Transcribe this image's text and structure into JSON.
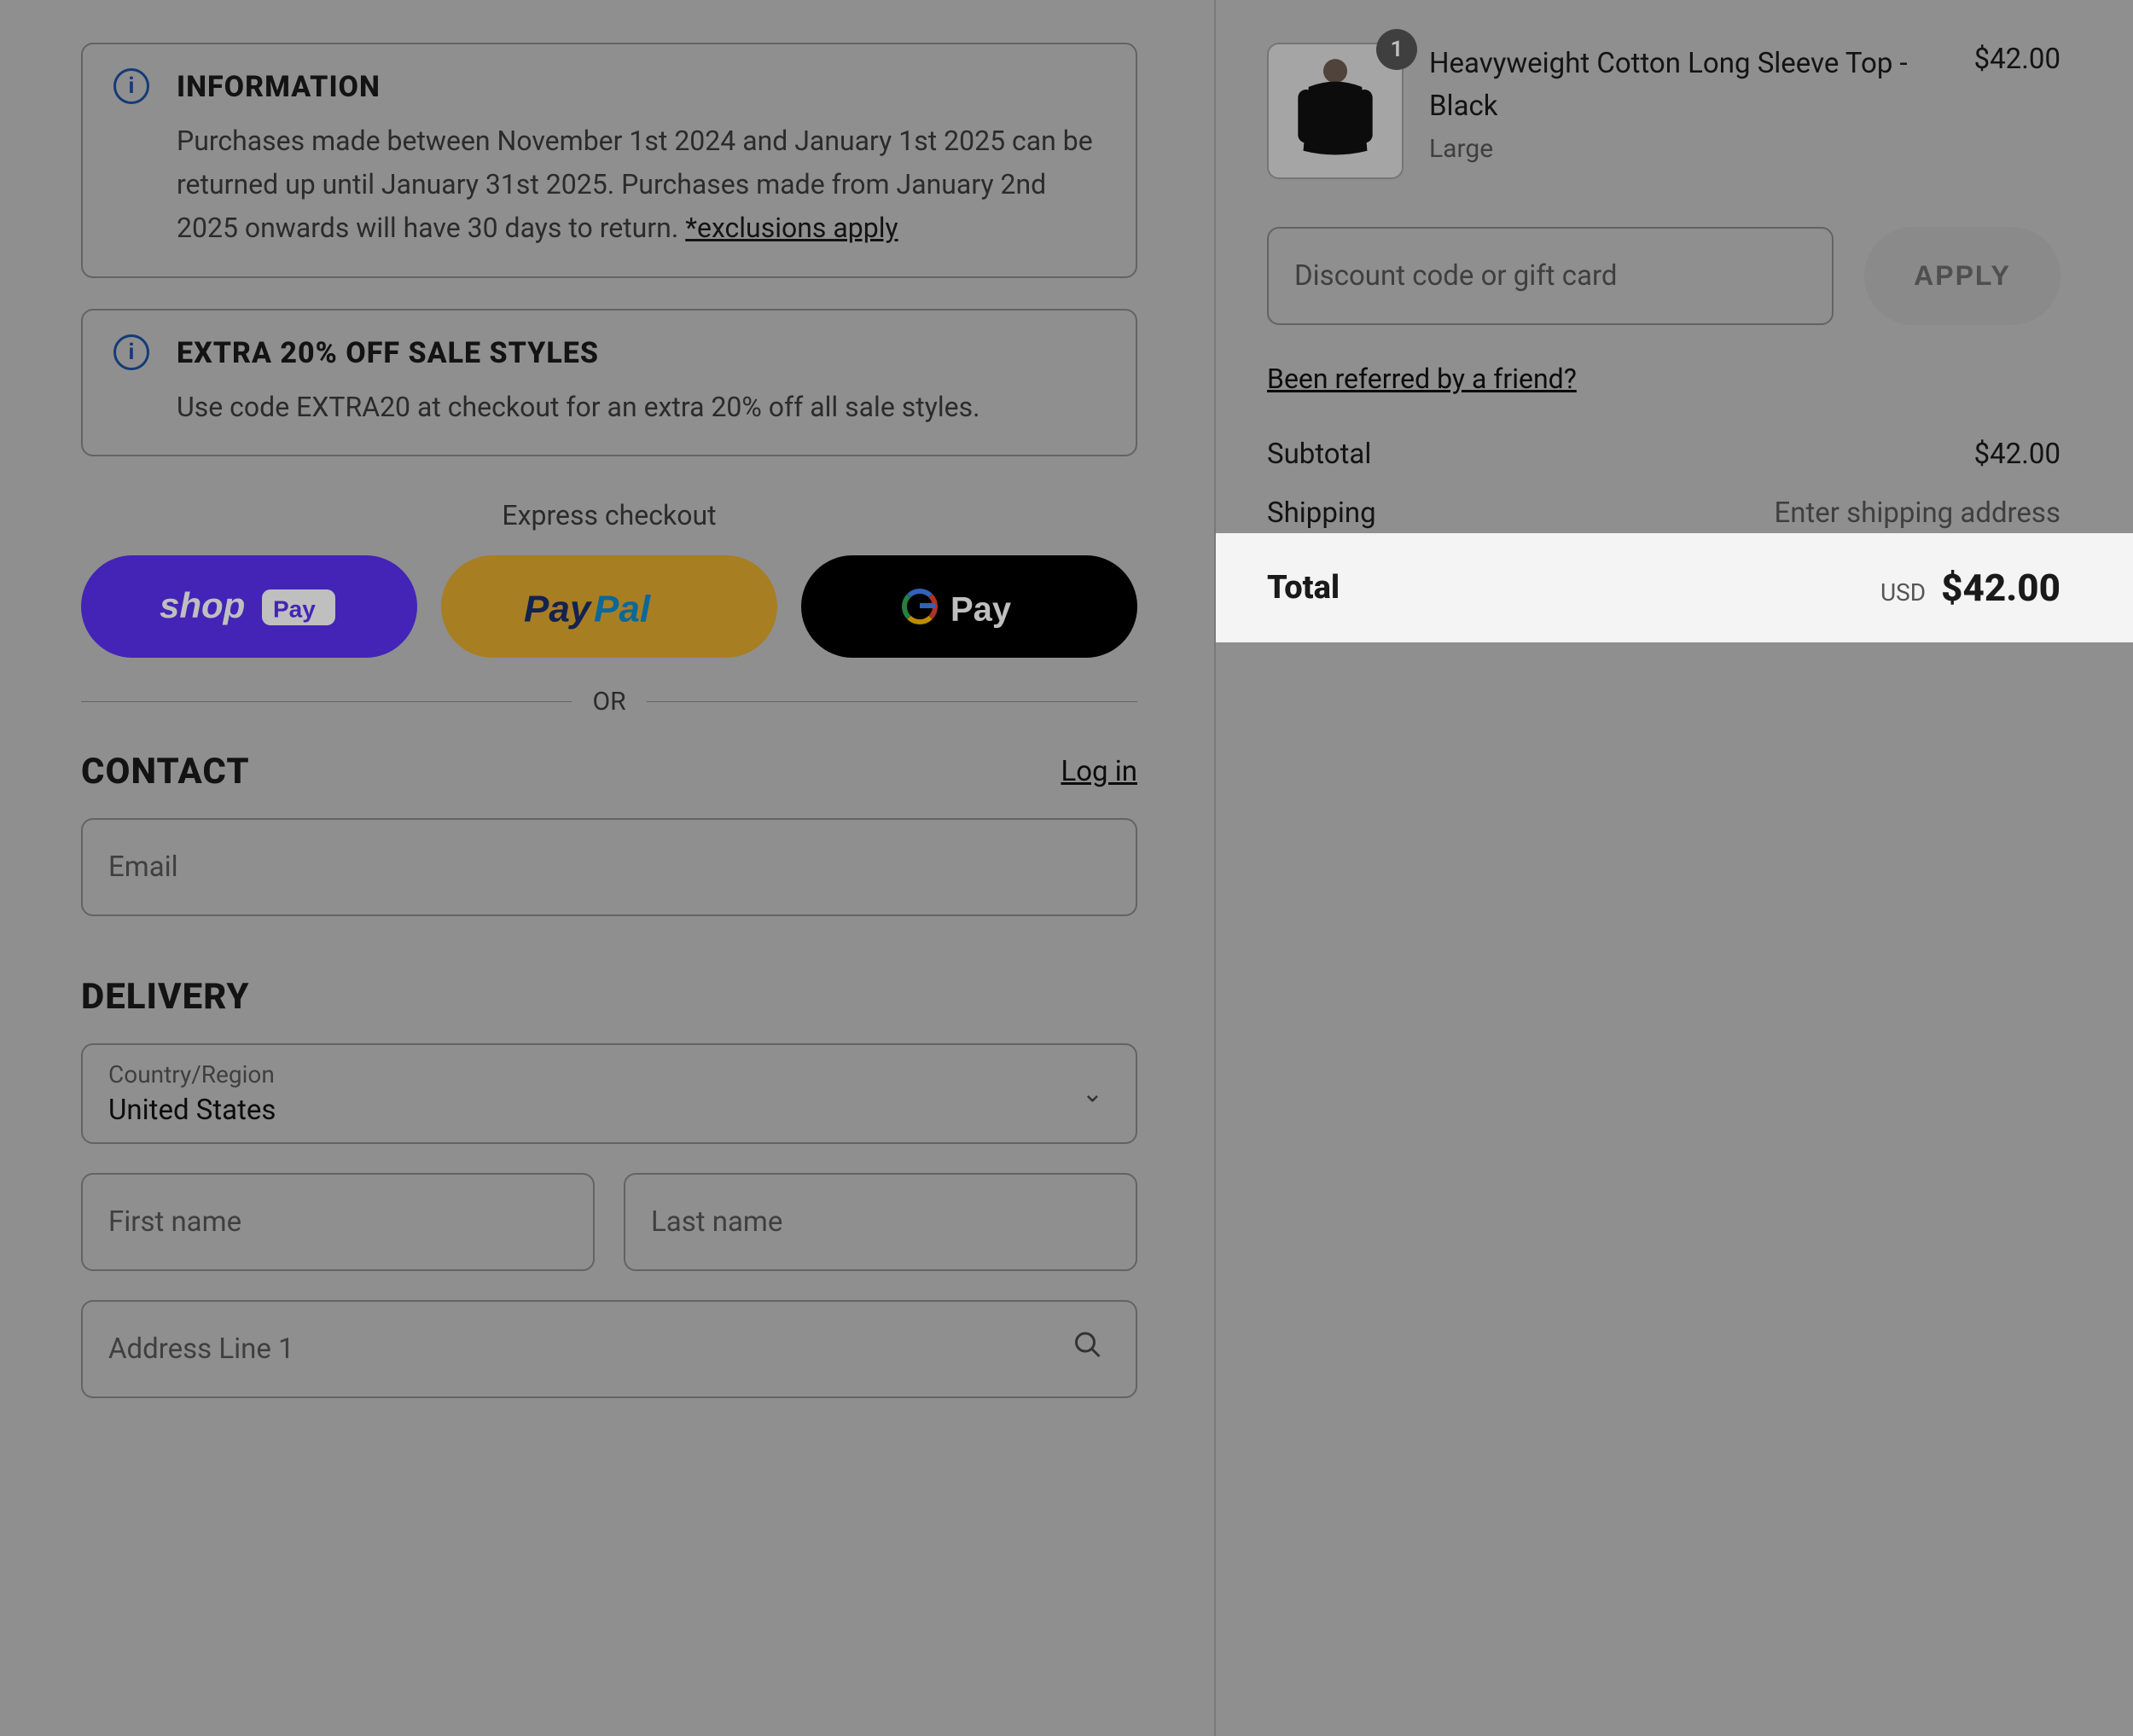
{
  "info_boxes": [
    {
      "title": "INFORMATION",
      "body_pre": "Purchases made between November 1st 2024 and January 1st 2025 can be returned up until January 31st 2025. Purchases made from January 2nd 2025 onwards will have 30 days to return. ",
      "link": "*exclusions apply"
    },
    {
      "title": "EXTRA 20% OFF SALE STYLES",
      "body_pre": "Use code EXTRA20 at checkout for an extra 20% off all sale styles.",
      "link": ""
    }
  ],
  "express_checkout_label": "Express checkout",
  "or_label": "OR",
  "contact": {
    "heading": "CONTACT",
    "login": "Log in",
    "email_placeholder": "Email"
  },
  "delivery": {
    "heading": "DELIVERY",
    "country_label": "Country/Region",
    "country_value": "United States",
    "first_name_placeholder": "First name",
    "last_name_placeholder": "Last name",
    "address1_placeholder": "Address Line 1"
  },
  "cart": {
    "item": {
      "name": "Heavyweight Cotton Long Sleeve Top - Black",
      "variant": "Large",
      "price": "$42.00",
      "qty": "1"
    },
    "discount_placeholder": "Discount code or gift card",
    "apply_label": "APPLY",
    "referral": "Been referred by a friend?",
    "subtotal_label": "Subtotal",
    "subtotal_value": "$42.00",
    "shipping_label": "Shipping",
    "shipping_value": "Enter shipping address",
    "total_label": "Total",
    "currency": "USD",
    "total_value": "$42.00"
  }
}
